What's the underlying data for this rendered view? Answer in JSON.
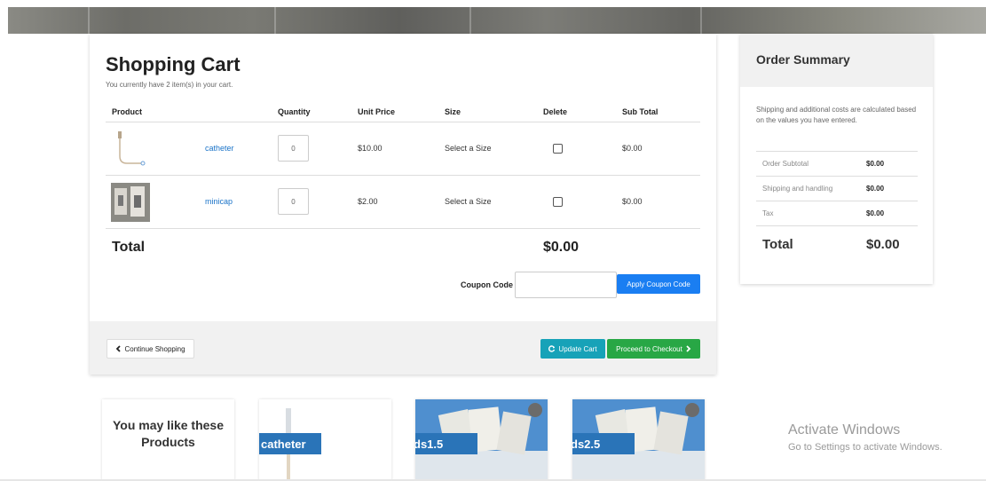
{
  "cart": {
    "title": "Shopping Cart",
    "subtitle": "You currently have 2 item(s) in your cart.",
    "headers": [
      "Product",
      "Quantity",
      "Unit Price",
      "Size",
      "Delete",
      "Sub Total"
    ],
    "items": [
      {
        "name": "catheter",
        "quantity": "0",
        "unit_price": "$10.00",
        "size": "Select a Size",
        "sub_total": "$0.00"
      },
      {
        "name": "minicap",
        "quantity": "0",
        "unit_price": "$2.00",
        "size": "Select a Size",
        "sub_total": "$0.00"
      }
    ],
    "total_label": "Total",
    "total_value": "$0.00",
    "coupon_label": "Coupon Code :",
    "coupon_value": "",
    "apply_coupon": "Apply Coupon Code",
    "continue_shopping": "Continue Shopping",
    "update_cart": "Update Cart",
    "checkout": "Proceed to Checkout"
  },
  "summary": {
    "title": "Order Summary",
    "note": "Shipping and additional costs are calculated based on the values you have entered.",
    "rows": [
      {
        "label": "Order Subtotal",
        "value": "$0.00"
      },
      {
        "label": "Shipping and handling",
        "value": "$0.00"
      },
      {
        "label": "Tax",
        "value": "$0.00"
      }
    ],
    "total_label": "Total",
    "total_value": "$0.00"
  },
  "recommend": {
    "title": "You may like these Products",
    "products": [
      {
        "name": "catheter"
      },
      {
        "name": "ds1.5"
      },
      {
        "name": "ds2.5"
      }
    ]
  },
  "watermark": {
    "line1": "Activate Windows",
    "line2": "Go to Settings to activate Windows."
  },
  "icons": {
    "continue": "chevron-left-icon",
    "update": "refresh-icon",
    "checkout": "chevron-right-icon"
  },
  "colors": {
    "primary": "#1a7ef2",
    "info": "#17a2b8",
    "success": "#28a745",
    "link": "#1a73c8",
    "banner": "#2a74b8"
  }
}
